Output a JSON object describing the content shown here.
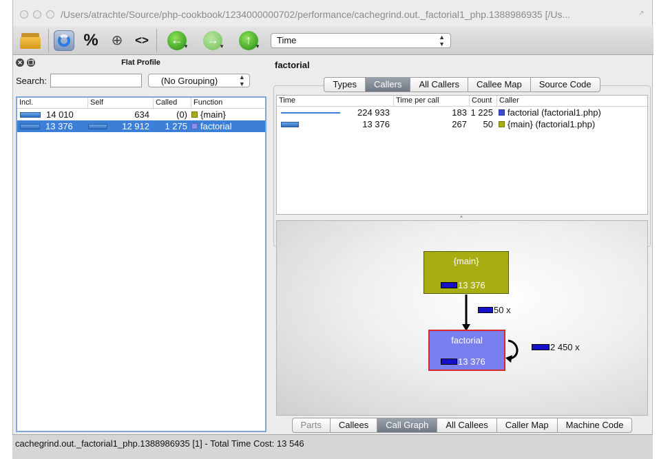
{
  "window": {
    "title": "/Users/atrachte/Source/php-cookbook/1234000000702/performance/cachegrind.out._factorial1_php.1388986935 [/Us..."
  },
  "toolbar": {
    "percent_label": "%",
    "move_label": "⊕",
    "cycle_label": "<>",
    "back_arrow": "←",
    "forward_arrow": "→",
    "up_arrow": "↑",
    "event_type": "Time",
    "icons": [
      "folder-open-icon",
      "reload-icon",
      "percent-icon",
      "move-icon",
      "cycle-icon",
      "back-icon",
      "forward-icon",
      "up-icon"
    ]
  },
  "left_panel": {
    "title": "Flat Profile",
    "search_label": "Search:",
    "search_value": "",
    "grouping": "(No Grouping)",
    "columns": [
      "Incl.",
      "Self",
      "Called",
      "Function"
    ],
    "rows": [
      {
        "incl": "14 010",
        "self": "634",
        "called": "(0)",
        "function": "{main}",
        "color": "#a8ad11",
        "incl_fraction": 1.0,
        "self_fraction": 0.0,
        "selected": false
      },
      {
        "incl": "13 376",
        "self": "12 912",
        "called": "1 275",
        "function": "factorial",
        "color": "#8a8ff0",
        "incl_fraction": 0.95,
        "self_fraction": 0.92,
        "selected": true
      }
    ]
  },
  "right_panel": {
    "function_name": "factorial",
    "top_tabs": [
      {
        "label": "Types",
        "active": false
      },
      {
        "label": "Callers",
        "active": true
      },
      {
        "label": "All Callers",
        "active": false
      },
      {
        "label": "Callee Map",
        "active": false
      },
      {
        "label": "Source Code",
        "active": false
      }
    ],
    "callers_columns": [
      "Time",
      "Time per call",
      "Count",
      "Caller"
    ],
    "callers_rows": [
      {
        "time": "224 933",
        "time_per_call": "183",
        "count": "1 225",
        "caller": "factorial (factorial1.php)",
        "color": "#3b4cd6",
        "bar": "line"
      },
      {
        "time": "13 376",
        "time_per_call": "267",
        "count": "50",
        "caller": "{main} (factorial1.php)",
        "color": "#a8ad11",
        "bar": "box"
      }
    ],
    "graph": {
      "main_node": {
        "label": "{main}",
        "cost": "13 376"
      },
      "factorial_node": {
        "label": "factorial",
        "cost": "13 376"
      },
      "edge_main_to_factorial": "50 x",
      "edge_recursive": "2 450 x"
    },
    "bottom_tabs": [
      {
        "label": "Parts",
        "active": false,
        "dim": true
      },
      {
        "label": "Callees",
        "active": false,
        "dim": false
      },
      {
        "label": "Call Graph",
        "active": true,
        "dim": false
      },
      {
        "label": "All Callees",
        "active": false,
        "dim": false
      },
      {
        "label": "Caller Map",
        "active": false,
        "dim": false
      },
      {
        "label": "Machine Code",
        "active": false,
        "dim": false
      }
    ]
  },
  "status": {
    "text": "cachegrind.out._factorial1_php.1388986935 [1] - Total Time Cost: 13 546"
  }
}
